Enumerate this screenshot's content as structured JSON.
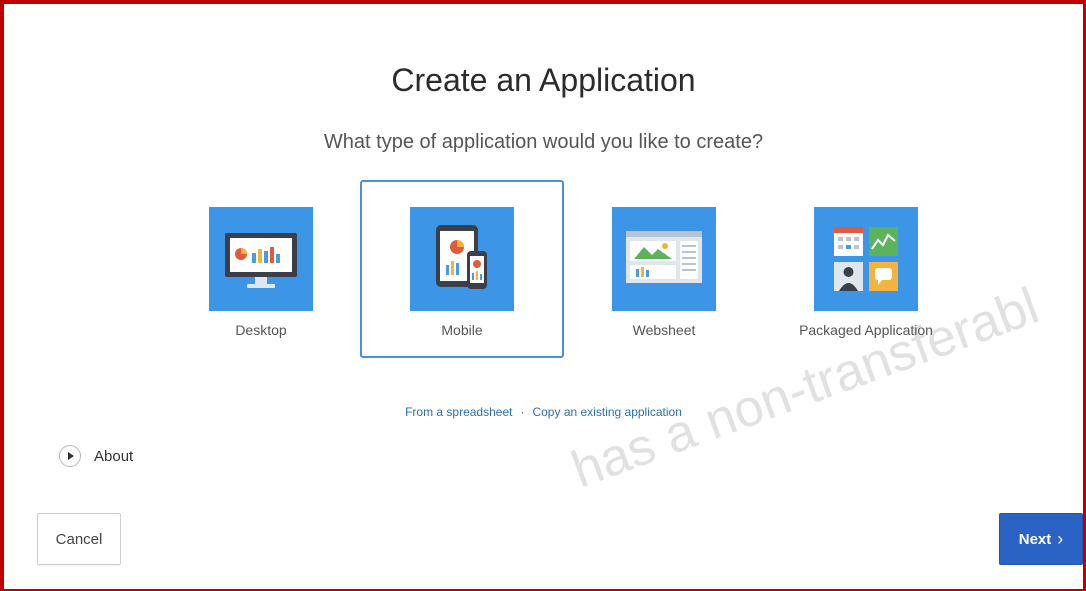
{
  "page": {
    "title": "Create an Application",
    "subtitle": "What type of application would you like to create?"
  },
  "app_types": [
    {
      "label": "Desktop",
      "icon": "desktop-monitor-icon",
      "selected": false
    },
    {
      "label": "Mobile",
      "icon": "mobile-devices-icon",
      "selected": true
    },
    {
      "label": "Websheet",
      "icon": "websheet-icon",
      "selected": false
    },
    {
      "label": "Packaged Application",
      "icon": "packaged-app-icon",
      "selected": false
    }
  ],
  "links": {
    "spreadsheet": "From a spreadsheet",
    "separator": "·",
    "copy": "Copy an existing application"
  },
  "about": {
    "label": "About",
    "icon": "play-circle-icon"
  },
  "buttons": {
    "cancel": "Cancel",
    "next": "Next",
    "next_icon": "chevron-right-icon",
    "next_chevron": "›"
  },
  "watermark": "has a non-transferabl",
  "colors": {
    "frame_border": "#c00000",
    "tile_blue": "#3d95e8",
    "selected_border": "#4a90d9",
    "link": "#2a6fb5",
    "primary_button": "#2b63c4"
  }
}
